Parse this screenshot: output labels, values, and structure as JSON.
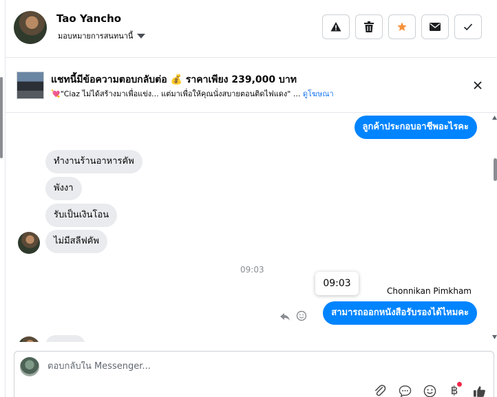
{
  "header": {
    "contact_name": "Tao Yancho",
    "assignment": "มอบหมายการสนทนานี้",
    "actions": [
      {
        "name": "report-button",
        "icon": "warning-icon"
      },
      {
        "name": "delete-button",
        "icon": "trash-icon"
      },
      {
        "name": "star-button",
        "icon": "star-icon",
        "color": "#f7923b"
      },
      {
        "name": "mark-unread-button",
        "icon": "envelope-icon"
      },
      {
        "name": "mark-done-button",
        "icon": "check-icon"
      }
    ]
  },
  "ad": {
    "title": "แชทนี้มีข้อความตอบกลับต่อ 💰 ราคาเพียง 239,000 บาท",
    "description": "💘\"Ciaz ไม่ได้สร้างมาเพื่อแข่ง... แต่มาเพื่อให้คุณนั่งสบายตอนติดไฟแดง\" ...",
    "link": "ดูโฆษณา"
  },
  "messages": {
    "out_top": "ลูกค้าประกอบอาชีพอะไรคะ",
    "incoming": [
      "ทำงานร้านอาหารคัพ",
      "พังงา",
      "รับเป็นเงินโอน",
      "ไม่มีสลีฟคัพ"
    ],
    "time": "09:03",
    "tooltip": "09:03",
    "sender": "Chonnikan Pimkham",
    "out_bottom": "สามารถออกหนังสือรับรองได้ไหมคะ"
  },
  "composer": {
    "placeholder": "ตอบกลับใน Messenger...",
    "tools": [
      "attachment-icon",
      "saved-reply-icon",
      "emoji-icon",
      "baht-payment-icon",
      "thumbs-up-icon"
    ],
    "baht_symbol": "฿"
  },
  "colors": {
    "accent": "#0084ff",
    "incoming_bubble": "#e9ebee",
    "link": "#1877f2",
    "notification": "#f02849"
  }
}
